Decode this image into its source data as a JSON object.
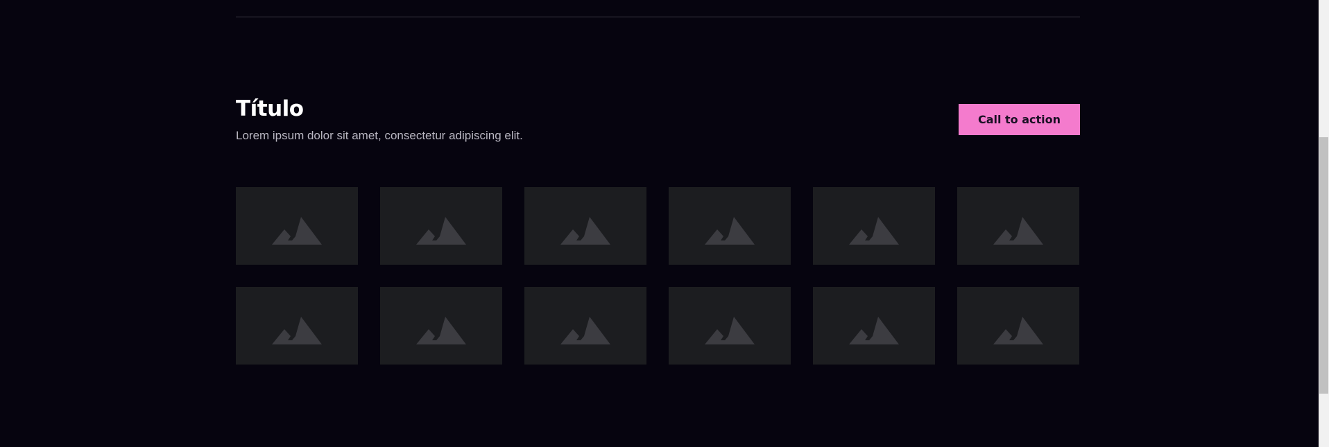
{
  "section": {
    "title": "Título",
    "subtitle": "Lorem ipsum dolor sit amet, consectetur adipiscing elit.",
    "cta_label": "Call to action"
  },
  "colors": {
    "background": "#06040f",
    "accent": "#f47bcd",
    "tile": "#1c1d20",
    "placeholder_icon": "#3c3c41"
  },
  "gallery": {
    "icon": "image-placeholder-icon",
    "rows": 2,
    "columns": 6
  }
}
